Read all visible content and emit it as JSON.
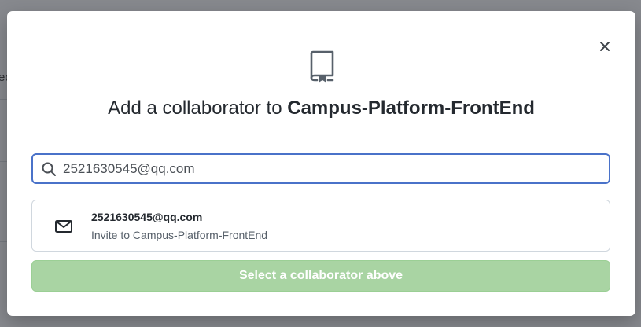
{
  "background": {
    "fragment_text": "ec"
  },
  "dialog": {
    "title_prefix": "Add a collaborator to ",
    "repo_name": "Campus-Platform-FrontEnd",
    "close_icon": "close-icon",
    "repo_icon": "repo-icon"
  },
  "search": {
    "value": "2521630545@qq.com",
    "icon": "search-icon"
  },
  "result": {
    "email": "2521630545@qq.com",
    "invite_text": "Invite to Campus-Platform-FrontEnd",
    "icon": "mail-icon"
  },
  "submit": {
    "label": "Select a collaborator above",
    "disabled": true
  },
  "colors": {
    "focus_border": "#4a72c9",
    "disabled_button": "#a9d4a3",
    "title_text": "#24292f"
  }
}
